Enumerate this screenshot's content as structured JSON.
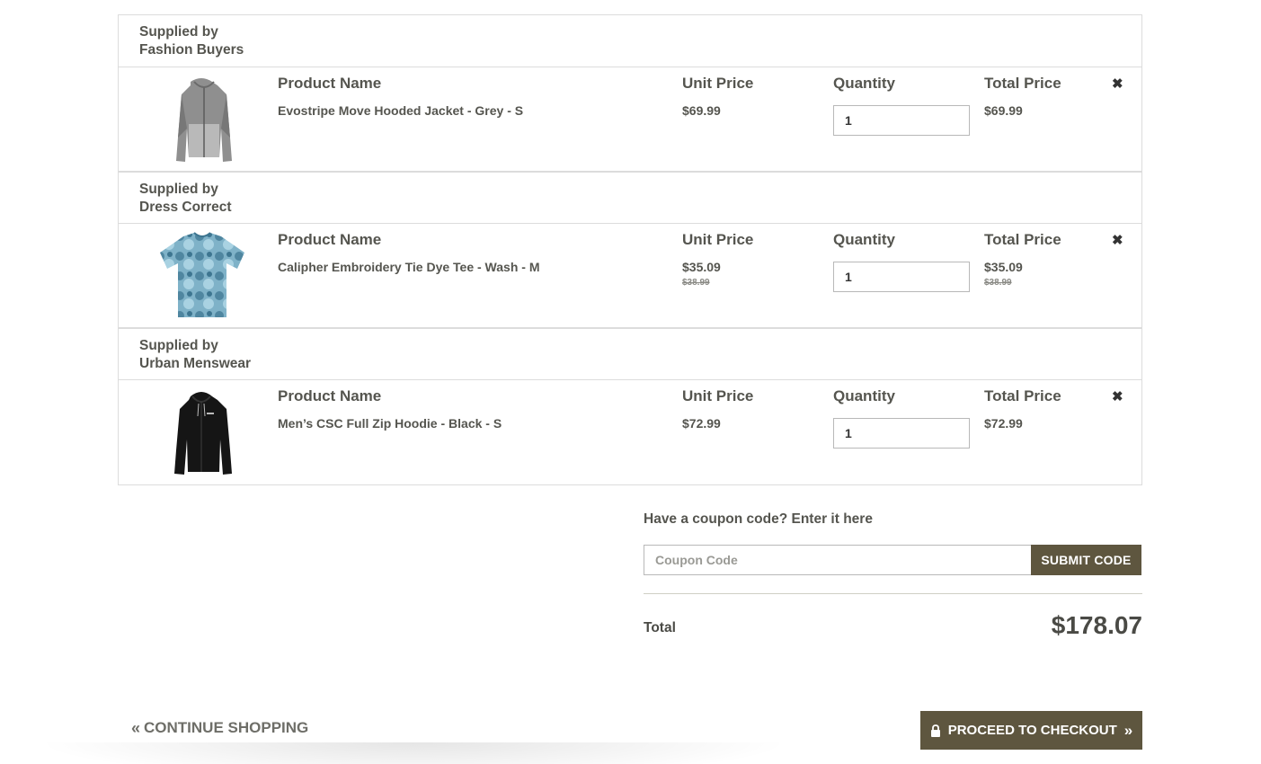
{
  "suppliers": [
    {
      "label": "Supplied by",
      "name": "Fashion Buyers",
      "item": {
        "product_name_header": "Product Name",
        "unit_price_header": "Unit Price",
        "quantity_header": "Quantity",
        "total_price_header": "Total Price",
        "name": "Evostripe Move Hooded Jacket - Grey - S",
        "unit_price": "$69.99",
        "unit_price_original": "",
        "quantity": "1",
        "total_price": "$69.99",
        "total_price_original": "",
        "image_icon": "grey-hooded-jacket-image",
        "remove_icon": "close-icon"
      }
    },
    {
      "label": "Supplied by",
      "name": "Dress Correct",
      "item": {
        "product_name_header": "Product Name",
        "unit_price_header": "Unit Price",
        "quantity_header": "Quantity",
        "total_price_header": "Total Price",
        "name": "Calipher Embroidery Tie Dye Tee - Wash - M",
        "unit_price": "$35.09",
        "unit_price_original": "$38.99",
        "quantity": "1",
        "total_price": "$35.09",
        "total_price_original": "$38.99",
        "image_icon": "tie-dye-tee-image",
        "remove_icon": "close-icon"
      }
    },
    {
      "label": "Supplied by",
      "name": "Urban Menswear",
      "item": {
        "product_name_header": "Product Name",
        "unit_price_header": "Unit Price",
        "quantity_header": "Quantity",
        "total_price_header": "Total Price",
        "name": "Men’s CSC Full Zip Hoodie - Black - S",
        "unit_price": "$72.99",
        "unit_price_original": "",
        "quantity": "1",
        "total_price": "$72.99",
        "total_price_original": "",
        "image_icon": "black-hoodie-image",
        "remove_icon": "close-icon"
      }
    }
  ],
  "coupon": {
    "title": "Have a coupon code? Enter it here",
    "placeholder": "Coupon Code",
    "value": "",
    "submit_label": "SUBMIT CODE"
  },
  "summary": {
    "total_label": "Total",
    "total_value": "$178.07"
  },
  "footer": {
    "continue_label": "CONTINUE SHOPPING",
    "continue_icon": "double-chevron-left-icon",
    "checkout_label": "PROCEED TO CHECKOUT",
    "checkout_lock_icon": "lock-icon",
    "checkout_arrow_icon": "double-chevron-right-icon"
  },
  "colors": {
    "accent": "#5e563f",
    "border": "#dcdcdc",
    "text": "#4a4a45"
  }
}
